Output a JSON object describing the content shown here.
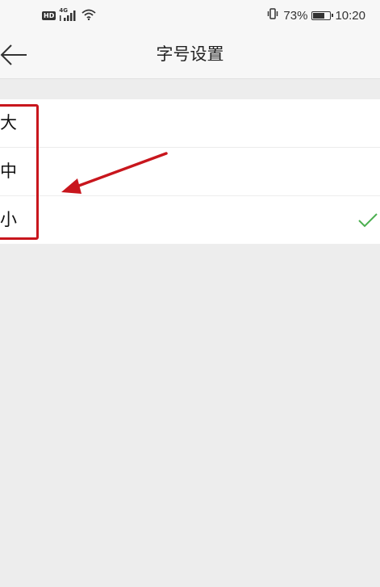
{
  "status_bar": {
    "hd_label": "HD",
    "network_label": "4G",
    "battery_percent": "73%",
    "battery_level": 0.73,
    "time": "10:20",
    "icons": [
      "vibrate-icon",
      "signal-icon",
      "wifi-icon",
      "battery-icon"
    ]
  },
  "nav": {
    "title": "字号设置",
    "back_icon": "arrow-left-icon"
  },
  "options": {
    "items": [
      {
        "label": "大",
        "selected": false
      },
      {
        "label": "中",
        "selected": false
      },
      {
        "label": "小",
        "selected": true
      }
    ],
    "selected_icon": "check-icon"
  },
  "colors": {
    "accent_check": "#4caf50",
    "annotation_red": "#c8161d",
    "background": "#ededed",
    "bar_background": "#f7f7f7"
  }
}
